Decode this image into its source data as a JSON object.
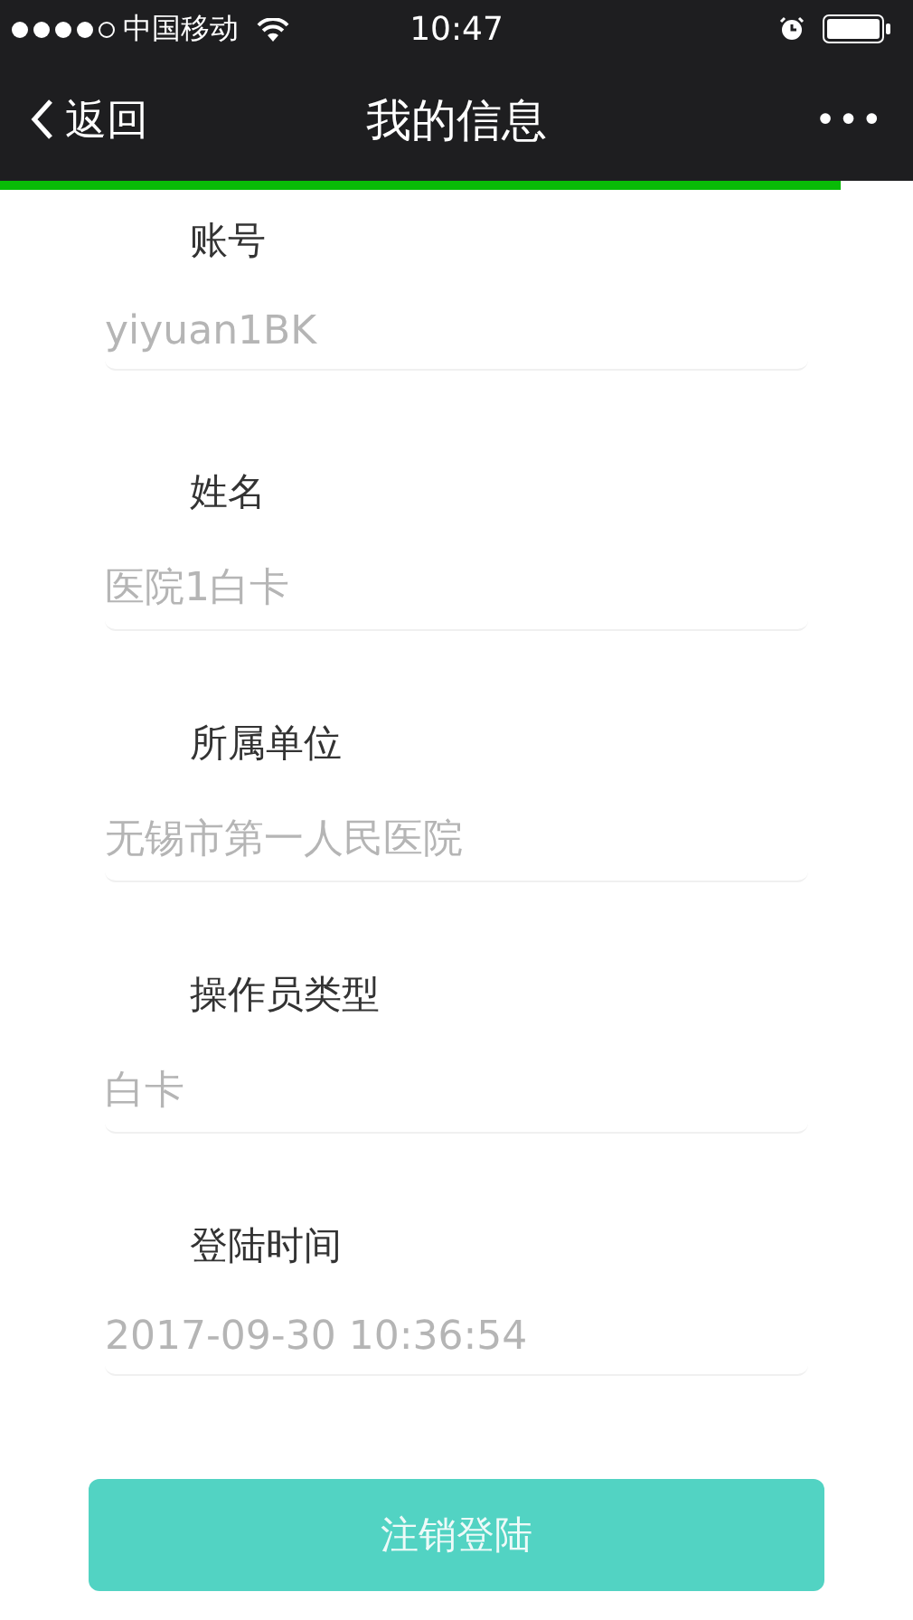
{
  "status_bar": {
    "carrier": "中国移动",
    "time": "10:47"
  },
  "nav": {
    "back": "返回",
    "title": "我的信息",
    "more": "•••"
  },
  "loading": {
    "level": 0.92
  },
  "fields": [
    {
      "label": "账号",
      "value": "yiyuan1BK"
    },
    {
      "label": "姓名",
      "value": "医院1白卡"
    },
    {
      "label": "所属单位",
      "value": "无锡市第一人民医院"
    },
    {
      "label": "操作员类型",
      "value": "白卡"
    },
    {
      "label": "登陆时间",
      "value": "2017-09-30 10:36:54"
    }
  ],
  "logout_button": "注销登陆"
}
